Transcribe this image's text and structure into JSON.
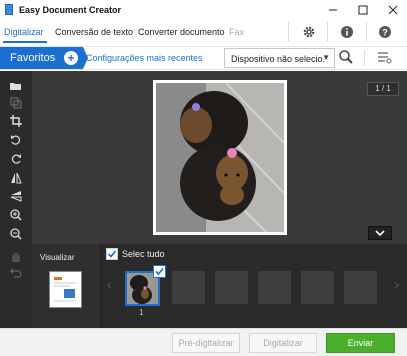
{
  "window": {
    "title": "Easy Document Creator"
  },
  "tabs": [
    {
      "label": "Digitalizar"
    },
    {
      "label": "Conversão de texto"
    },
    {
      "label": "Converter documento"
    },
    {
      "label": "Fax"
    }
  ],
  "favorites": {
    "label": "Favoritos",
    "add_symbol": "+"
  },
  "recent_settings": {
    "label": "Configurações mais recentes"
  },
  "device": {
    "selected": "Dispositivo não selecio.",
    "caret": "▼"
  },
  "preview": {
    "page_counter": "1 / 1"
  },
  "visualize": {
    "label": "Visualizar"
  },
  "select_all": {
    "label": "Selec tudo",
    "checked": true
  },
  "thumbnails": [
    {
      "number": "1",
      "selected": true
    }
  ],
  "footer": {
    "prescan": "Pré-digitalizar",
    "scan": "Digitalizar",
    "send": "Enviar"
  },
  "colors": {
    "accent": "#1b6fd0",
    "send": "#4caf2c",
    "dark_panel": "#3a3a3a"
  },
  "icons": {
    "toolbar": [
      "settings-icon",
      "info-icon",
      "help-icon"
    ],
    "left_tools": [
      "open-folder-icon",
      "copy-icon",
      "crop-icon",
      "rotate-left-icon",
      "rotate-right-icon",
      "flip-icon",
      "mirror-icon",
      "zoom-in-icon",
      "zoom-out-icon",
      "hand-icon",
      "undo-icon"
    ]
  }
}
